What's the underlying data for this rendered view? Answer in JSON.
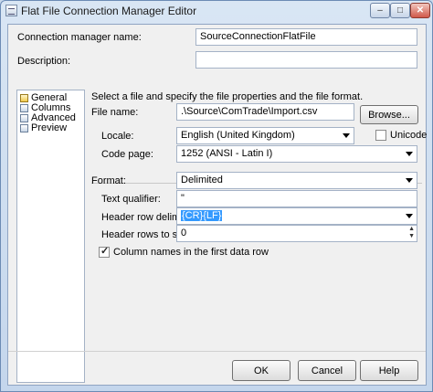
{
  "window": {
    "title": "Flat File Connection Manager Editor",
    "minimize": "–",
    "maximize": "□",
    "close": "✕"
  },
  "header": {
    "connection_name_label": "Connection manager name:",
    "connection_name_value": "SourceConnectionFlatFile",
    "description_label": "Description:",
    "description_value": ""
  },
  "nav": {
    "items": [
      "General",
      "Columns",
      "Advanced",
      "Preview"
    ],
    "selected": "General"
  },
  "general": {
    "intro": "Select a file and specify the file properties and the file format.",
    "file_name_label": "File name:",
    "file_name_value": ".\\Source\\ComTrade\\Import.csv",
    "browse_label": "Browse...",
    "locale_label": "Locale:",
    "locale_value": "English (United Kingdom)",
    "unicode_label": "Unicode",
    "unicode_checked": false,
    "code_page_label": "Code page:",
    "code_page_value": "1252  (ANSI - Latin I)",
    "format_label": "Format:",
    "format_value": "Delimited",
    "text_qualifier_label": "Text qualifier:",
    "text_qualifier_value": "\"",
    "header_row_delimiter_label": "Header row delimiter:",
    "header_row_delimiter_value": "{CR}{LF}",
    "header_rows_skip_label": "Header rows to skip:",
    "header_rows_skip_value": "0",
    "column_names_label": "Column names in the first data row",
    "column_names_checked": true
  },
  "footer": {
    "ok_label": "OK",
    "cancel_label": "Cancel",
    "help_label": "Help"
  }
}
